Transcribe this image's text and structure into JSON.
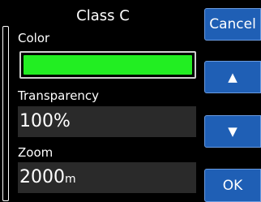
{
  "dialog": {
    "title": "Class C"
  },
  "fields": {
    "color": {
      "label": "Color",
      "value_color": "#22ee22"
    },
    "transparency": {
      "label": "Transparency",
      "value": "100%"
    },
    "zoom": {
      "label": "Zoom",
      "value": "2000",
      "unit": "m"
    }
  },
  "buttons": {
    "cancel": "Cancel",
    "up": "▲",
    "down": "▼",
    "ok": "OK"
  },
  "colors": {
    "background": "#000000",
    "button": "#1f5fb5",
    "field": "#2a2a2a"
  }
}
